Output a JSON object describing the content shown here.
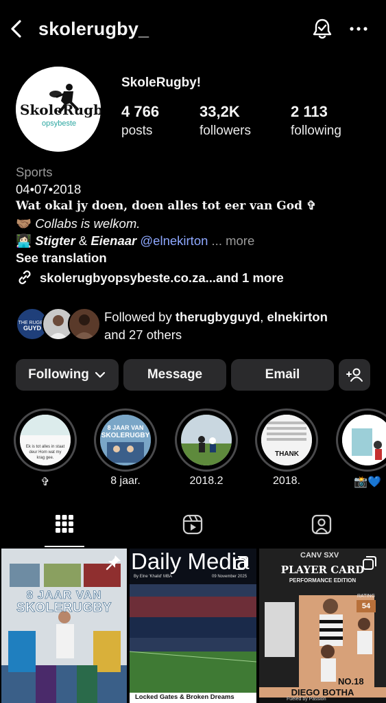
{
  "header": {
    "username": "skolerugby_"
  },
  "profile": {
    "display_name": "SkoleRugby!",
    "logo_text_1": "SkoleRugby",
    "logo_text_2": "opsybeste",
    "stats": [
      {
        "value": "4 766",
        "label": "posts"
      },
      {
        "value": "33,2K",
        "label": "followers"
      },
      {
        "value": "2 113",
        "label": "following"
      }
    ]
  },
  "bio": {
    "category": "Sports",
    "date": "04•07•2018",
    "motto": "Wat okal jy doen, doen alles tot eer van God ✞",
    "collabs": "Collabs is welkom.",
    "founder_1": "Stigter",
    "founder_and": " & ",
    "founder_2": "Eienaar",
    "founder_mention": "@elnekirton",
    "more": "... more",
    "see_translation": "See translation",
    "link": "skolerugbyopsybeste.co.za...",
    "link_more": " and 1 more"
  },
  "followed_by": {
    "prefix": "Followed by ",
    "user_1": "therugbyguyd",
    "sep": ", ",
    "user_2": "elnekirton",
    "line_2": "and 27 others"
  },
  "buttons": {
    "following": "Following",
    "message": "Message",
    "email": "Email"
  },
  "highlights": [
    {
      "label": "✞"
    },
    {
      "label": "8 jaar."
    },
    {
      "label": "2018.2"
    },
    {
      "label": "2018."
    },
    {
      "label": "📸💙"
    }
  ],
  "posts": {
    "post_1_title_1": "8 JAAR VAN",
    "post_1_title_2": "SKOLERUGBY",
    "post_2_title": "Daily Media",
    "post_2_byline": "By Elne 'Khalid' MBA",
    "post_2_date": "09 November 2025",
    "post_2_caption": "Locked Gates & Broken Dreams",
    "post_3_brand": "CANV SXV",
    "post_3_title": "PLAYER CARD",
    "post_3_subtitle": "PERFORMANCE EDITION",
    "post_3_rating_label": "RATING",
    "post_3_rating": "54",
    "post_3_number": "NO.18",
    "post_3_name": "DIEGO BOTHA",
    "post_3_footer": "Fueled by Passion"
  },
  "colors": {
    "background": "#000000",
    "button_bg": "#2a2a2c",
    "mention": "#8ea8ff",
    "muted": "#9a9a9a"
  }
}
